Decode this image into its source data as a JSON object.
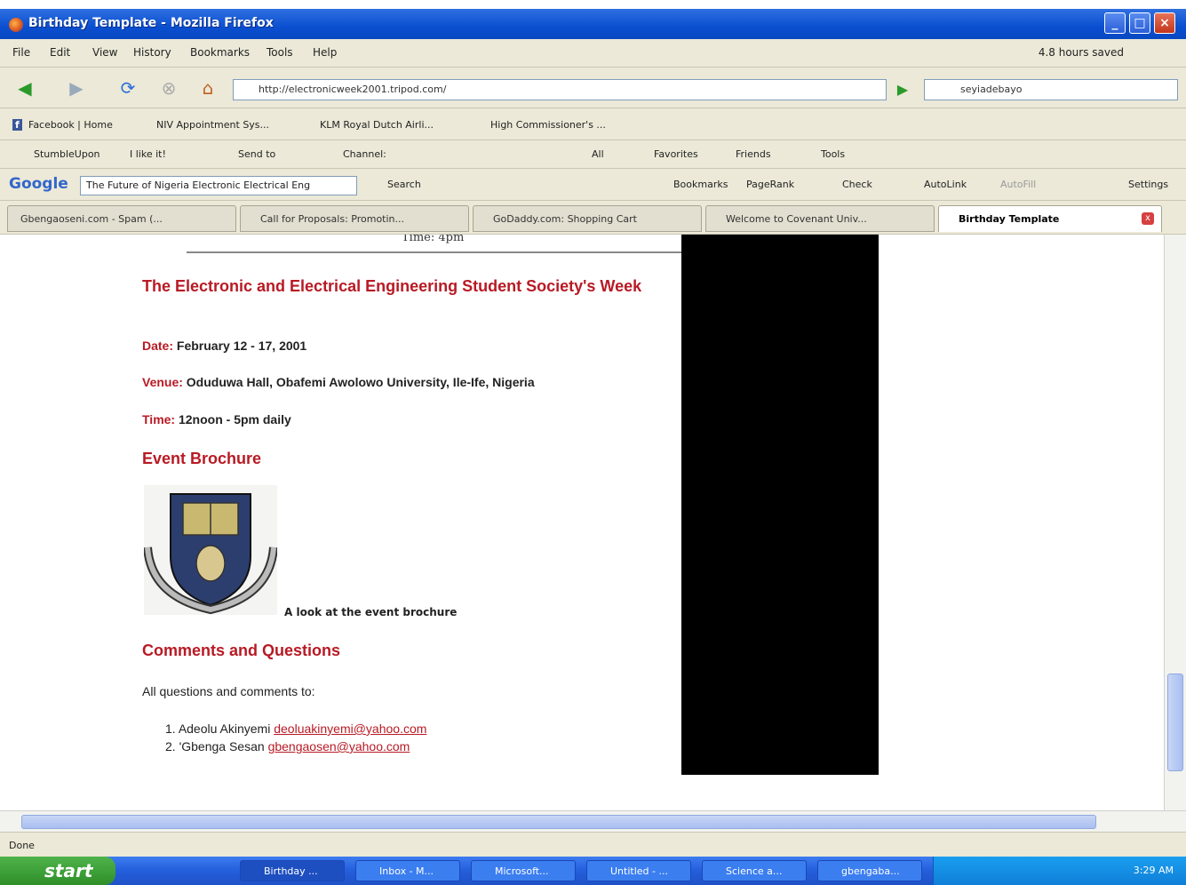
{
  "window": {
    "title": "Birthday Template - Mozilla Firefox"
  },
  "menu": {
    "items": [
      "File",
      "Edit",
      "View",
      "History",
      "Bookmarks",
      "Tools",
      "Help"
    ],
    "saved": "4.8 hours saved"
  },
  "nav": {
    "url": "http://electronicweek2001.tripod.com/",
    "search": "seyiadebayo"
  },
  "bookmarks": [
    "Facebook | Home",
    "NIV Appointment Sys...",
    "KLM Royal Dutch Airli...",
    "High Commissioner's ..."
  ],
  "suite": [
    "StumbleUpon",
    "I like it!",
    "Send to",
    "Channel:",
    "All",
    "Favorites",
    "Friends",
    "Tools"
  ],
  "google": {
    "query": "The Future of Nigeria Electronic Electrical Eng",
    "search": "Search",
    "bookmarks": "Bookmarks",
    "pagerank": "PageRank",
    "check": "Check",
    "autolink": "AutoLink",
    "autofill": "AutoFill",
    "settings": "Settings"
  },
  "tabs": [
    "Gbengaoseni.com - Spam (...",
    "Call for Proposals: Promotin...",
    "GoDaddy.com: Shopping Cart",
    "Welcome to Covenant Univ...",
    "Birthday Template"
  ],
  "page": {
    "time_preview": "Time: 4pm",
    "event_title": "The Electronic and Electrical Engineering Student Society's Week",
    "date_label": "Date:",
    "date_value": "February 12 - 17, 2001",
    "venue_label": "Venue:",
    "venue_value": "Oduduwa Hall, Obafemi Awolowo University, Ile-Ife, Nigeria",
    "time_label": "Time:",
    "time_value": "12noon - 5pm daily",
    "brochure_heading": "Event Brochure",
    "brochure_caption": "A look at the event brochure",
    "comments_heading": "Comments and Questions",
    "comments_intro": "All questions and comments to:",
    "contacts": [
      {
        "num": "1.",
        "name": "Adeolu Akinyemi",
        "email": "deoluakinyemi@yahoo.com"
      },
      {
        "num": "2.",
        "name": "'Gbenga Sesan",
        "email": "gbengaosen@yahoo.com"
      }
    ]
  },
  "status": "Done",
  "taskbar": {
    "start": "start",
    "tasks": [
      "Birthday ...",
      "Inbox - M...",
      "Microsoft...",
      "Untitled - ...",
      "Science a...",
      "gbengaba..."
    ],
    "clock": "3:29 AM"
  },
  "colors": {
    "heading_red": "#b81a24",
    "title_blue": "#0a4fd0",
    "taskbar_blue": "#245edb"
  }
}
